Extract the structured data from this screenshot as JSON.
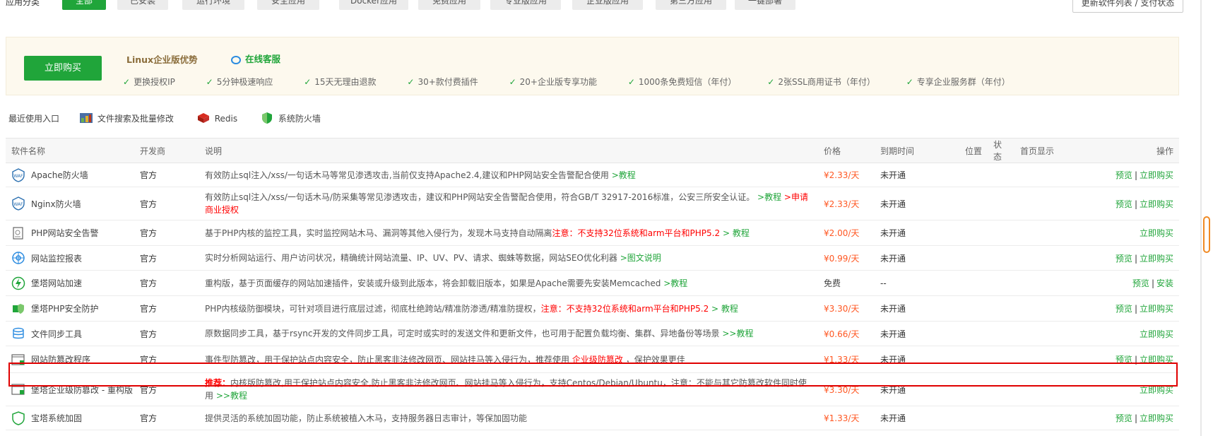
{
  "categories": {
    "label": "应用分类",
    "tabs": [
      "全部",
      "已安装",
      "运行环境",
      "安全应用",
      "Docker应用",
      "免费应用",
      "专业版应用",
      "企业版应用",
      "第三方应用",
      "一键部署"
    ],
    "update_button": "更新软件列表 / 支付状态"
  },
  "promo": {
    "buy_button": "立即购买",
    "title": "Linux企业版优势",
    "service": "在线客服",
    "features": [
      "更换授权IP",
      "5分钟极速响应",
      "15天无理由退款",
      "30+款付费插件",
      "20+企业版专享功能",
      "1000条免费短信（年付）",
      "2张SSL商用证书（年付）",
      "专享企业服务群（年付）"
    ]
  },
  "recent": {
    "label": "最近使用入口",
    "items": [
      "文件搜索及批量修改",
      "Redis",
      "系统防火墙"
    ]
  },
  "table": {
    "headers": {
      "name": "软件名称",
      "dev": "开发商",
      "desc": "说明",
      "price": "价格",
      "expire": "到期时间",
      "position": "位置",
      "status": "状态",
      "home": "首页显示",
      "ops": "操作"
    },
    "rows": [
      {
        "name": "Apache防火墙",
        "dev": "官方",
        "desc": "有效防止sql注入/xss/一句话木马等常见渗透攻击,当前仅支持Apache2.4,建议和PHP网站安全告警配合使用",
        "desc_green": ">教程",
        "desc_red": "",
        "desc_tail": "",
        "price": "¥2.33/天",
        "expire": "未开通",
        "op1": "预览",
        "op2": "立即购买"
      },
      {
        "name": "Nginx防火墙",
        "dev": "官方",
        "desc": "有效防止sql注入/xss/一句话木马/防采集等常见渗透攻击，建议和PHP网站安全告警配合使用，符合GB/T 32917-2016标准，公安三所安全认证。",
        "desc_green": ">教程",
        "desc_red": ">申请商业授权",
        "desc_tail": "",
        "price": "¥2.33/天",
        "expire": "未开通",
        "op1": "预览",
        "op2": "立即购买"
      },
      {
        "name": "PHP网站安全告警",
        "dev": "官方",
        "desc": "基于PHP内核的监控工具，实时监控网站木马、漏洞等其他入侵行为，发现木马支持自动隔离",
        "desc_red": "注意：不支持32位系统和arm平台和PHP5.2",
        "desc_green": "> 教程",
        "desc_tail": "",
        "price": "¥2.00/天",
        "expire": "未开通",
        "op1": "",
        "op2": "立即购买"
      },
      {
        "name": "网站监控报表",
        "dev": "官方",
        "desc": "实时分析网站运行、用户访问状况，精确统计网站流量、IP、UV、PV、请求、蜘蛛等数据，网站SEO优化利器",
        "desc_green": ">图文说明",
        "desc_red": "",
        "desc_tail": "",
        "price": "¥0.99/天",
        "expire": "未开通",
        "op1": "预览",
        "op2": "立即购买"
      },
      {
        "name": "堡塔网站加速",
        "dev": "官方",
        "desc": "重构版，基于页面缓存的网站加速插件，安装或升级到此版本，将会卸载旧版本，如果是Apache需要先安装Memcached",
        "desc_green": ">教程",
        "desc_red": "",
        "desc_tail": "",
        "price": "免费",
        "expire": "--",
        "op1": "预览",
        "op2": "安装"
      },
      {
        "name": "堡塔PHP安全防护",
        "dev": "官方",
        "desc": "PHP内核级防御模块，可针对项目进行底层过滤，彻底杜绝跨站/精准防渗透/精准防提权，",
        "desc_red": "注意：不支持32位系统和arm平台和PHP5.2",
        "desc_green": "> 教程",
        "desc_tail": "",
        "price": "¥3.30/天",
        "expire": "未开通",
        "op1": "预览",
        "op2": "立即购买"
      },
      {
        "name": "文件同步工具",
        "dev": "官方",
        "desc": "原数据同步工具，基于rsync开发的文件同步工具，可定时或实时的发送文件和更新文件，也可用于配置负载均衡、集群、异地备份等场景",
        "desc_green": ">>教程",
        "desc_red": "",
        "desc_tail": "",
        "price": "¥0.66/天",
        "expire": "未开通",
        "op1": "",
        "op2": "立即购买"
      },
      {
        "name": "网站防篡改程序",
        "dev": "官方",
        "desc": "事件型防篡改，用于保护站点内容安全，防止黑客非法修改网页、网站挂马等入侵行为，推荐使用",
        "desc_red": "企业级防篡改",
        "desc_green": "",
        "desc_tail": "，保护效果更佳",
        "price": "¥1.33/天",
        "expire": "未开通",
        "op1": "预览",
        "op2": "立即购买"
      },
      {
        "name": "堡塔企业级防篡改 - 重构版",
        "dev": "官方",
        "desc_lead": "推荐：",
        "desc": "内核版防篡改,用于保护站点内容安全,防止黑客非法修改网页、网站挂马等入侵行为，支持Centos/Debian/Ubuntu，注意：不能与其它防篡改软件同时使用",
        "desc_green": ">>教程",
        "desc_red": "",
        "desc_tail": "",
        "price": "¥3.30/天",
        "expire": "未开通",
        "op1": "",
        "op2": "立即购买"
      },
      {
        "name": "宝塔系统加固",
        "dev": "官方",
        "desc": "提供灵活的系统加固功能，防止系统被植入木马，支持服务器日志审计，等保加固功能",
        "desc_green": "",
        "desc_red": "",
        "desc_tail": "",
        "price": "¥1.33/天",
        "expire": "未开通",
        "op1": "预览",
        "op2": "立即购买"
      }
    ]
  },
  "colors": {
    "accent": "#20a53a",
    "price": "#ff5722",
    "warning": "#ff0000",
    "highlight": "#e00000"
  }
}
